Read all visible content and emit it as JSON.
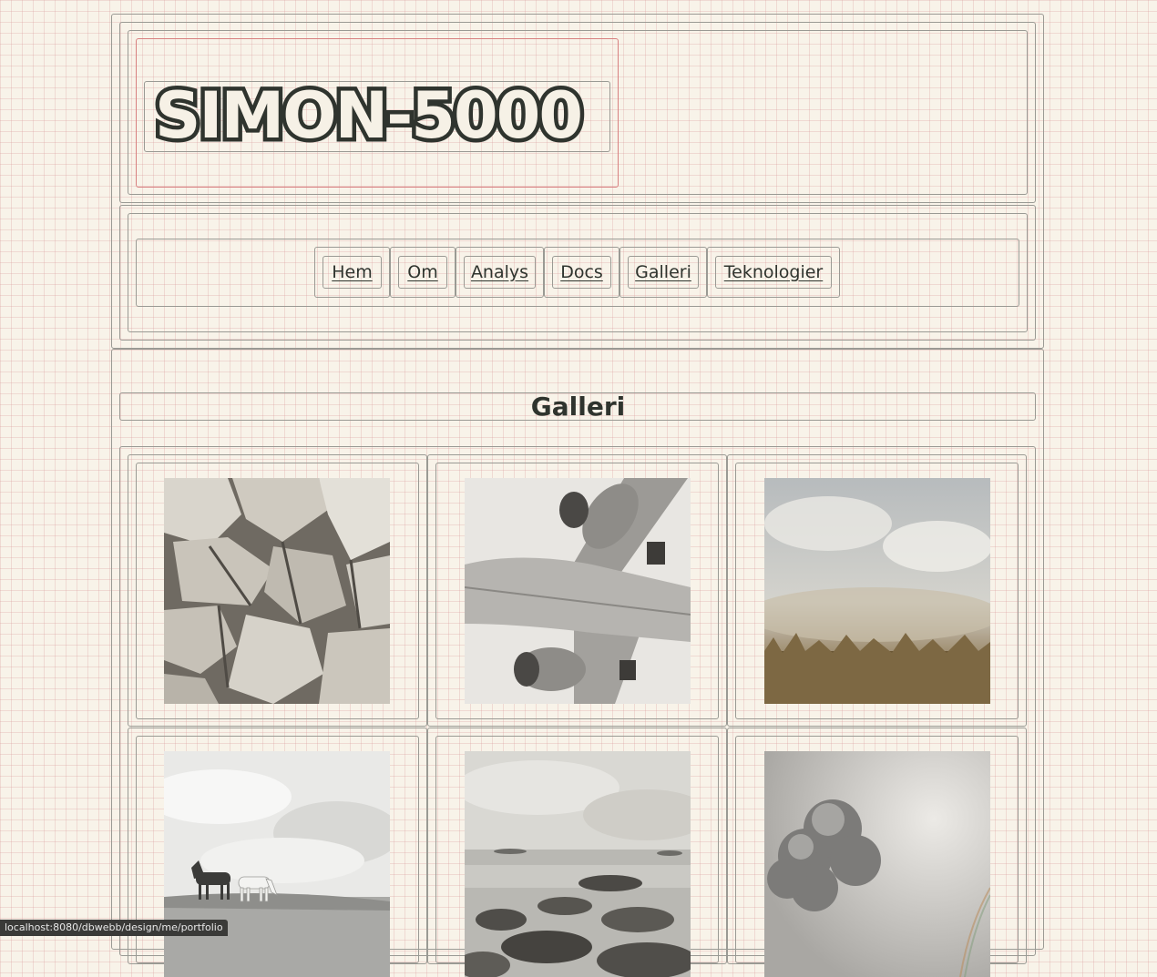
{
  "header": {
    "logo_text": "SIMON-5000"
  },
  "navigation": {
    "links": [
      {
        "label": "Hem"
      },
      {
        "label": "Om"
      },
      {
        "label": "Analys"
      },
      {
        "label": "Docs"
      },
      {
        "label": "Galleri"
      },
      {
        "label": "Teknologier"
      }
    ]
  },
  "main": {
    "title": "Galleri",
    "photos": [
      {
        "subject": "rocks"
      },
      {
        "subject": "airplane"
      },
      {
        "subject": "foggy-field"
      },
      {
        "subject": "horses"
      },
      {
        "subject": "rocky-shore"
      },
      {
        "subject": "cloud"
      }
    ]
  },
  "status_bar": {
    "url": "localhost:8080/dbwebb/design/me/portfolio"
  },
  "colors": {
    "background": "#f8f3e9",
    "text": "#2f342e",
    "border": "#9a9a94",
    "logo_frame": "#d88080"
  }
}
